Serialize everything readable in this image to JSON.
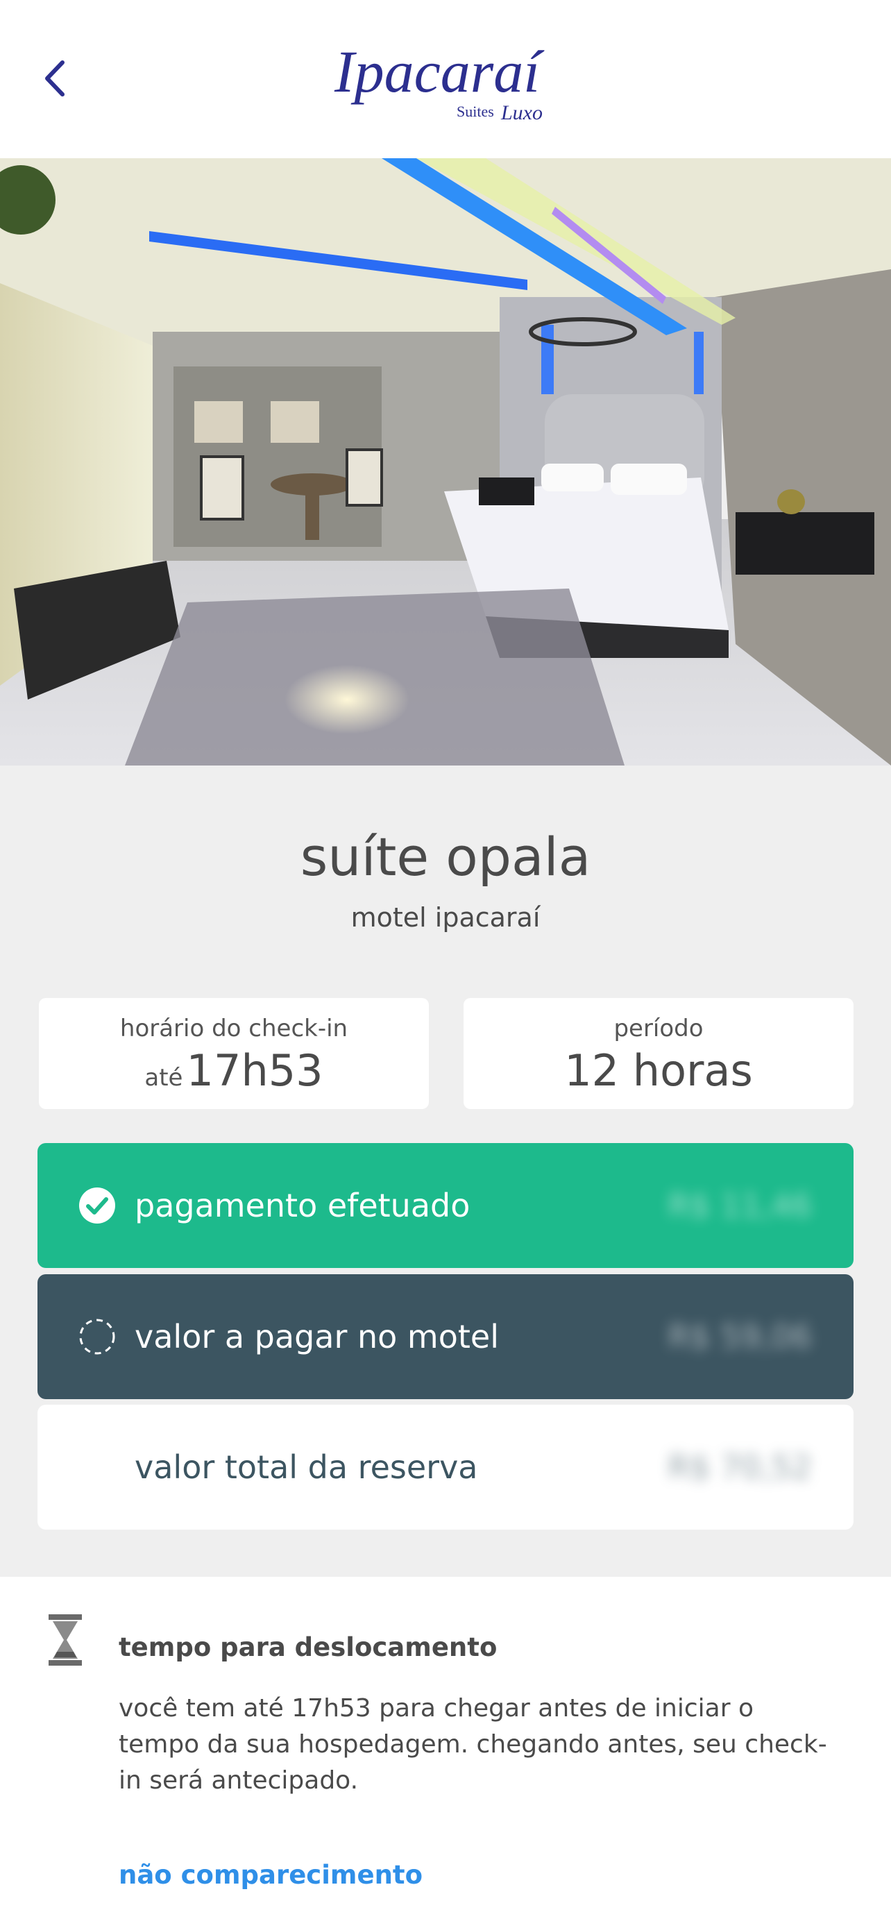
{
  "header": {
    "back_icon": "chevron-left-icon",
    "logo_text": "Ipacaraí",
    "logo_subtext_1": "Suites",
    "logo_subtext_2": "Luxo",
    "brand_color": "#2c2f8f"
  },
  "suite": {
    "name": "suíte opala",
    "motel": "motel ipacaraí"
  },
  "checkin": {
    "label": "horário do check-in",
    "prefix": "até",
    "value": "17h53"
  },
  "period": {
    "label": "período",
    "value": "12 horas"
  },
  "payments": {
    "paid": {
      "icon": "check-circle-icon",
      "label": "pagamento efetuado",
      "amount": "R$ 11,46",
      "color": "#1dba8c"
    },
    "due": {
      "icon": "dashed-circle-icon",
      "label": "valor a pagar no motel",
      "amount": "R$ 59,06",
      "color": "#3c5561"
    },
    "total": {
      "label": "valor total da reserva",
      "amount": "R$ 70,52"
    }
  },
  "travel": {
    "icon": "hourglass-icon",
    "title": "tempo para deslocamento",
    "text": "você tem até 17h53 para chegar antes de iniciar o tempo da sua hospedagem. chegando antes, seu check-in será antecipado.",
    "no_show_link": "não comparecimento",
    "link_color": "#2f8fe8"
  }
}
